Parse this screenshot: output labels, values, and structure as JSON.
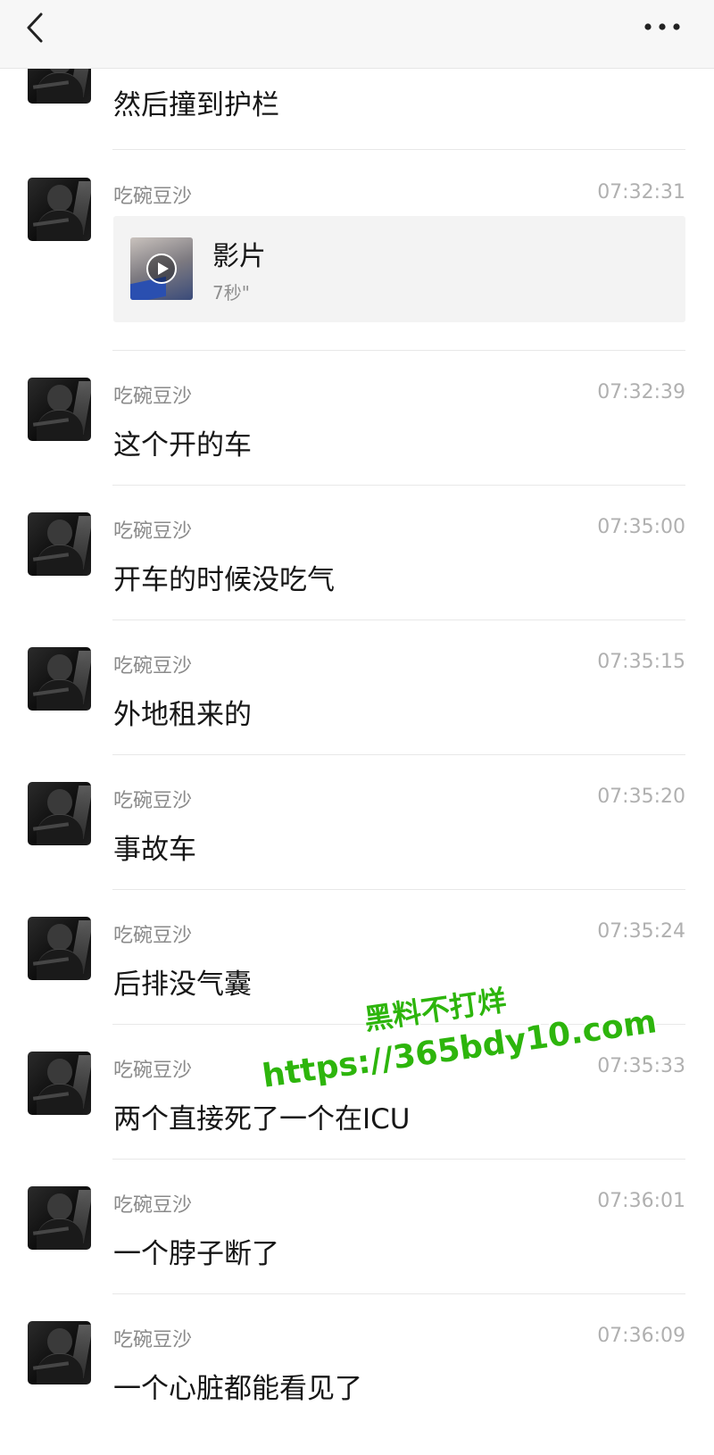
{
  "header": {
    "back_icon": "chevron-left-icon",
    "more_icon": "more-dots-icon"
  },
  "messages": [
    {
      "text": "然后撞到护栏"
    },
    {
      "sender": "吃碗豆沙",
      "time": "07:32:31",
      "video": {
        "title": "影片",
        "duration": "7秒\""
      }
    },
    {
      "sender": "吃碗豆沙",
      "time": "07:32:39",
      "text": "这个开的车"
    },
    {
      "sender": "吃碗豆沙",
      "time": "07:35:00",
      "text": "开车的时候没吃气"
    },
    {
      "sender": "吃碗豆沙",
      "time": "07:35:15",
      "text": "外地租来的"
    },
    {
      "sender": "吃碗豆沙",
      "time": "07:35:20",
      "text": "事故车"
    },
    {
      "sender": "吃碗豆沙",
      "time": "07:35:24",
      "text": "后排没气囊"
    },
    {
      "sender": "吃碗豆沙",
      "time": "07:35:33",
      "text": "两个直接死了一个在ICU"
    },
    {
      "sender": "吃碗豆沙",
      "time": "07:36:01",
      "text": "一个脖子断了"
    },
    {
      "sender": "吃碗豆沙",
      "time": "07:36:09",
      "text": "一个心脏都能看见了"
    }
  ],
  "watermark": {
    "line1": "黑料不打烊",
    "line2": "https://365bdy10.com"
  },
  "colors": {
    "watermark": "#2db50c",
    "name": "#8a8a8a",
    "time": "#b0b0b0",
    "header_bg": "#f7f7f7"
  }
}
